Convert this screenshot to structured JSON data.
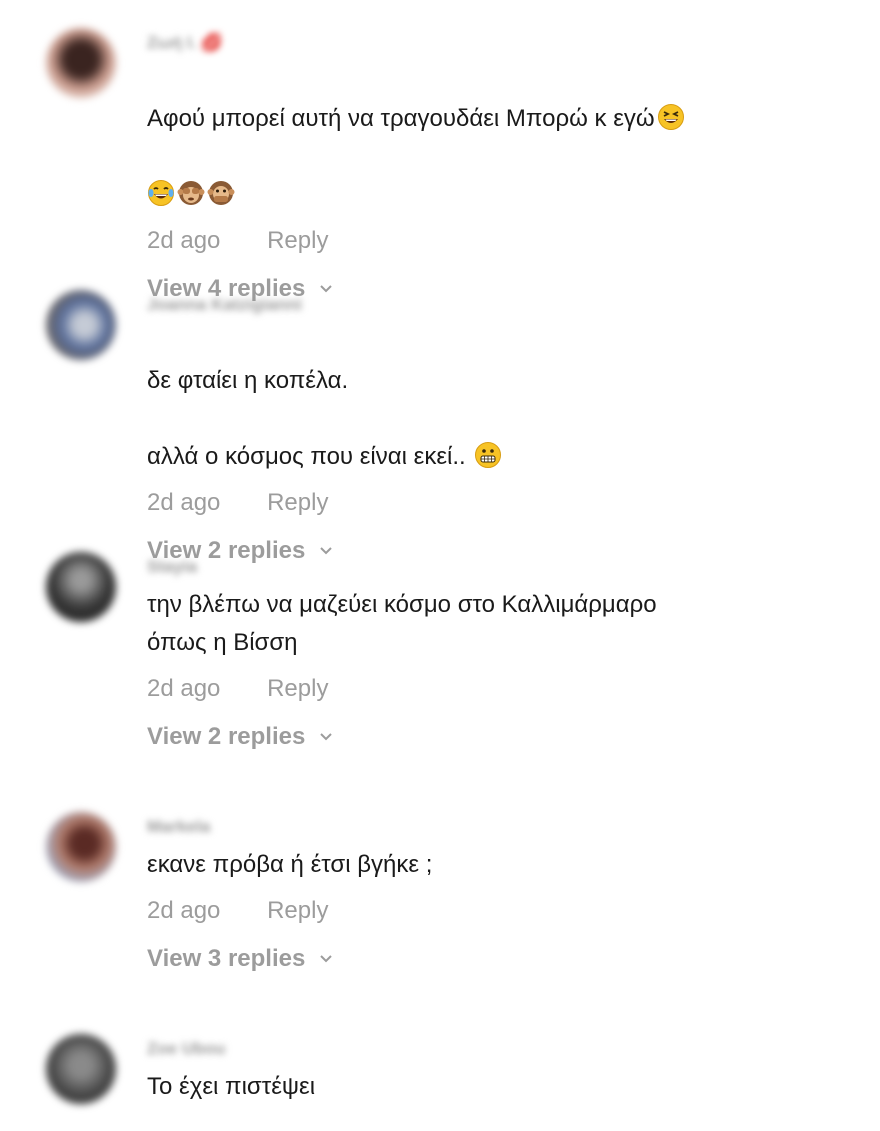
{
  "comments": [
    {
      "username": "Ζωή Ι. 💋",
      "text": "Αφού μπορεί αυτή να τραγουδάει Μπορώ κ εγώ",
      "time": "2d ago",
      "reply_label": "Reply",
      "view_replies": "View 4 replies",
      "avatar_color": "#6b4a44"
    },
    {
      "username": "Joanna Katzigianni",
      "text_line1": "δε φταίει η κοπέλα.",
      "text_line2": "αλλά ο κόσμος που είναι εκεί.. ",
      "time": "2d ago",
      "reply_label": "Reply",
      "view_replies": "View 2 replies",
      "avatar_color": "#4d5f86"
    },
    {
      "username": "Stayia",
      "text": "την βλέπω να μαζεύει κόσμο στο Καλλιμάρμαρο\nόπως η Βίσση",
      "time": "2d ago",
      "reply_label": "Reply",
      "view_replies": "View 2 replies",
      "avatar_color": "#3e3e3e"
    },
    {
      "username": "Markela",
      "text": "εκανε πρόβα ή έτσι βγήκε ;",
      "time": "2d ago",
      "reply_label": "Reply",
      "view_replies": "View 3 replies",
      "avatar_color": "#7a5150"
    },
    {
      "username": "Zoe Ubou",
      "text": "Το έχει πιστέψει",
      "avatar_color": "#4a4a4a"
    }
  ],
  "icons": {
    "laugh_emoji": "grinning-squinting-face-icon",
    "tears_emoji": "face-with-tears-of-joy-icon",
    "see_no_evil": "see-no-evil-monkey-icon",
    "speak_no_evil": "speak-no-evil-monkey-icon",
    "grimace_emoji": "grimacing-face-icon",
    "chevron": "chevron-down-icon"
  }
}
